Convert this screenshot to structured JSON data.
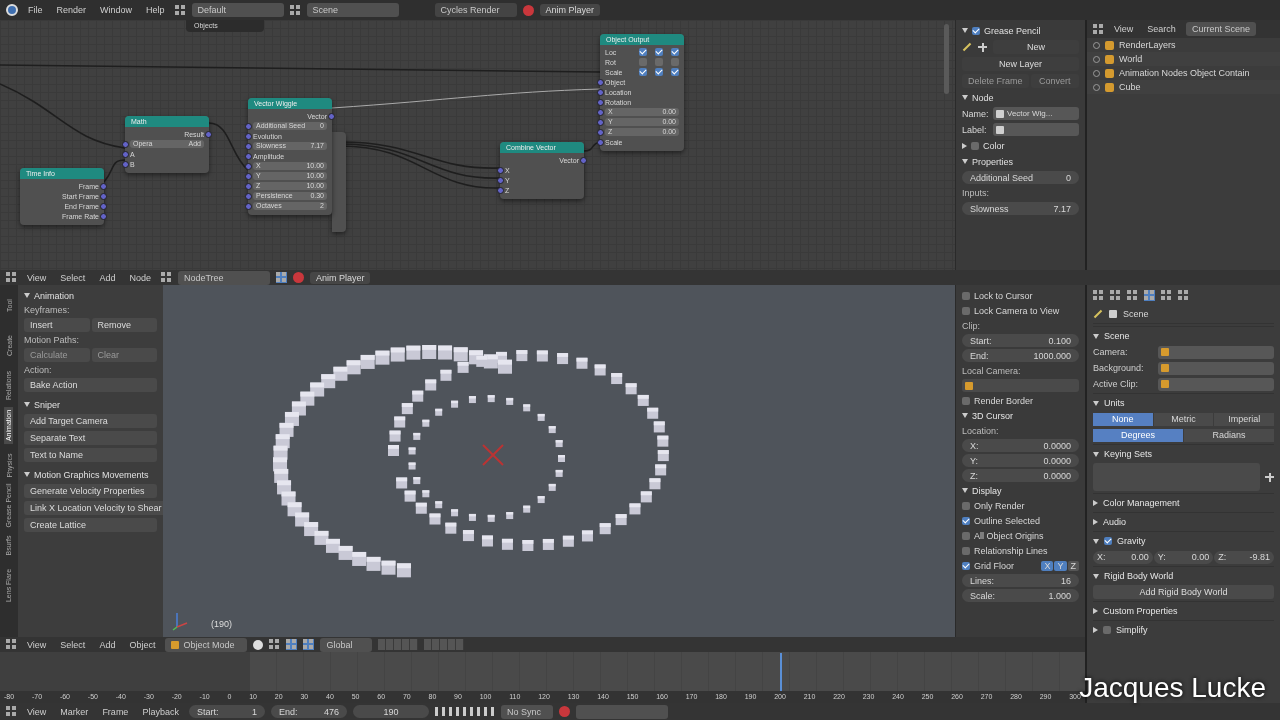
{
  "top_bar": {
    "menus": [
      "File",
      "Render",
      "Window",
      "Help"
    ],
    "layout": "Default",
    "scene": "Scene",
    "engine": "Cycles Render",
    "anim_player": "Anim Player"
  },
  "node_editor": {
    "popup": "Objects",
    "nodes": [
      {
        "title": "Time Info",
        "rows": [
          {
            "kind": "out",
            "text": "Frame"
          },
          {
            "kind": "out",
            "text": "Start Frame"
          },
          {
            "kind": "out",
            "text": "End Frame"
          },
          {
            "kind": "out",
            "text": "Frame Rate"
          }
        ]
      },
      {
        "title": "Math",
        "rows": [
          {
            "kind": "out",
            "text": "Result"
          },
          {
            "kind": "value",
            "text": "Opera",
            "value": "Add"
          },
          {
            "kind": "in",
            "text": "A"
          },
          {
            "kind": "in",
            "text": "B"
          }
        ]
      },
      {
        "title": "Vector Wiggle",
        "rows": [
          {
            "kind": "out",
            "text": "Vector"
          },
          {
            "kind": "value",
            "text": "Additional Seed",
            "value": "0"
          },
          {
            "kind": "in",
            "text": "Evolution"
          },
          {
            "kind": "value",
            "text": "Slowness",
            "value": "7.17"
          },
          {
            "kind": "in",
            "text": "Amplitude"
          },
          {
            "kind": "value",
            "text": "X",
            "value": "10.00"
          },
          {
            "kind": "value",
            "text": "Y",
            "value": "10.00"
          },
          {
            "kind": "value",
            "text": "Z",
            "value": "10.00"
          },
          {
            "kind": "value",
            "text": "Persistence",
            "value": "0.30"
          },
          {
            "kind": "value",
            "text": "Octaves",
            "value": "2"
          }
        ]
      },
      {
        "title": "Combine Vector",
        "rows": [
          {
            "kind": "out",
            "text": "Vector"
          },
          {
            "kind": "in",
            "text": "X"
          },
          {
            "kind": "in",
            "text": "Y"
          },
          {
            "kind": "in",
            "text": "Z"
          }
        ]
      },
      {
        "title": "Object Output",
        "rows": [
          {
            "kind": "checks",
            "text": "Loc",
            "checks": [
              true,
              true,
              true
            ]
          },
          {
            "kind": "checks",
            "text": "Rot",
            "checks": [
              false,
              false,
              false
            ]
          },
          {
            "kind": "checks",
            "text": "Scale",
            "checks": [
              true,
              true,
              true
            ]
          },
          {
            "kind": "in",
            "text": "Object"
          },
          {
            "kind": "in",
            "text": "Location"
          },
          {
            "kind": "in",
            "text": "Rotation"
          },
          {
            "kind": "value",
            "text": "X",
            "value": "0.00"
          },
          {
            "kind": "value",
            "text": "Y",
            "value": "0.00"
          },
          {
            "kind": "value",
            "text": "Z",
            "value": "0.00"
          },
          {
            "kind": "in",
            "text": "Scale"
          }
        ]
      }
    ],
    "header": {
      "menus": [
        "View",
        "Select",
        "Add",
        "Node"
      ],
      "tree": "NodeTree",
      "anim_player": "Anim Player"
    }
  },
  "node_panel": {
    "grease_pencil": {
      "title": "Grease Pencil",
      "checked": true,
      "new": "New",
      "new_layer": "New Layer",
      "delete_frame": "Delete Frame",
      "convert": "Convert"
    },
    "node_section": "Node",
    "name_label": "Name:",
    "name_value": "Vector Wig...",
    "label_label": "Label:",
    "color_section": "Color",
    "color_checked": false,
    "properties_section": "Properties",
    "seed_label": "Additional Seed",
    "seed_value": "0",
    "inputs_label": "Inputs:",
    "slowness_label": "Slowness",
    "slowness_value": "7.17"
  },
  "outliner": {
    "menus": [
      "View",
      "Search"
    ],
    "display": "Current Scene",
    "items": [
      {
        "label": "RenderLayers"
      },
      {
        "label": "World"
      },
      {
        "label": "Animation Nodes Object Contain"
      },
      {
        "label": "Cube"
      }
    ]
  },
  "tool_shelf": {
    "tabs": [
      {
        "label": "Tool",
        "selected": false
      },
      {
        "label": "Create",
        "selected": false
      },
      {
        "label": "Relations",
        "selected": false
      },
      {
        "label": "Animation",
        "selected": true
      },
      {
        "label": "Physics",
        "selected": false
      },
      {
        "label": "Grease Pencil",
        "selected": false
      },
      {
        "label": "Bsurfs",
        "selected": false
      },
      {
        "label": "Lens Flare",
        "selected": false
      }
    ],
    "sections": [
      {
        "title": "Animation",
        "expanded": true,
        "items": [
          {
            "kind": "label",
            "text": "Keyframes:"
          },
          {
            "kind": "buttons",
            "buttons": [
              {
                "text": "Insert",
                "disabled": false
              },
              {
                "text": "Remove",
                "disabled": false
              }
            ]
          },
          {
            "kind": "label",
            "text": "Motion Paths:"
          },
          {
            "kind": "buttons",
            "buttons": [
              {
                "text": "Calculate",
                "disabled": true
              },
              {
                "text": "Clear",
                "disabled": true
              }
            ]
          },
          {
            "kind": "label",
            "text": "Action:"
          },
          {
            "kind": "buttons",
            "buttons": [
              {
                "text": "Bake Action",
                "disabled": false
              }
            ]
          }
        ]
      },
      {
        "title": "Sniper",
        "expanded": true,
        "items": [
          {
            "kind": "buttons",
            "buttons": [
              {
                "text": "Add Target Camera",
                "disabled": false
              }
            ]
          },
          {
            "kind": "buttons",
            "buttons": [
              {
                "text": "Separate Text",
                "disabled": false
              }
            ]
          },
          {
            "kind": "buttons",
            "buttons": [
              {
                "text": "Text to Name",
                "disabled": false
              }
            ]
          }
        ]
      },
      {
        "title": "Motion Graphics Movements",
        "expanded": true,
        "items": [
          {
            "kind": "buttons",
            "buttons": [
              {
                "text": "Generate Velocity Properties",
                "disabled": false
              }
            ]
          },
          {
            "kind": "buttons",
            "buttons": [
              {
                "text": "Link X Location Velocity to Shear",
                "disabled": false
              }
            ]
          },
          {
            "kind": "buttons",
            "buttons": [
              {
                "text": "Create Lattice",
                "disabled": false
              }
            ]
          }
        ]
      }
    ]
  },
  "viewport": {
    "frame": "(190)"
  },
  "view_panel": {
    "items": [
      {
        "kind": "check",
        "text": "Lock to Cursor",
        "checked": false
      },
      {
        "kind": "check",
        "text": "Lock Camera to View",
        "checked": false
      },
      {
        "kind": "label",
        "text": "Clip:"
      },
      {
        "kind": "num",
        "text": "Start:",
        "value": "0.100"
      },
      {
        "kind": "num",
        "text": "End:",
        "value": "1000.000"
      },
      {
        "kind": "label",
        "text": "Local Camera:"
      },
      {
        "kind": "picker"
      },
      {
        "kind": "check",
        "text": "Render Border",
        "checked": false
      },
      {
        "kind": "section",
        "text": "3D Cursor",
        "expanded": true
      },
      {
        "kind": "label",
        "text": "Location:"
      },
      {
        "kind": "num",
        "text": "X:",
        "value": "0.0000"
      },
      {
        "kind": "num",
        "text": "Y:",
        "value": "0.0000"
      },
      {
        "kind": "num",
        "text": "Z:",
        "value": "0.0000"
      },
      {
        "kind": "section",
        "text": "Display",
        "expanded": true
      },
      {
        "kind": "check",
        "text": "Only Render",
        "checked": false
      },
      {
        "kind": "check",
        "text": "Outline Selected",
        "checked": true
      },
      {
        "kind": "check",
        "text": "All Object Origins",
        "checked": false
      },
      {
        "kind": "check",
        "text": "Relationship Lines",
        "checked": false
      },
      {
        "kind": "axes",
        "text": "Grid Floor",
        "checked": true,
        "axes": [
          {
            "text": "X",
            "selected": true
          },
          {
            "text": "Y",
            "selected": true
          },
          {
            "text": "Z",
            "selected": false
          }
        ]
      },
      {
        "kind": "num",
        "text": "Lines:",
        "value": "16"
      },
      {
        "kind": "num",
        "text": "Scale:",
        "value": "1.000"
      }
    ]
  },
  "properties": {
    "breadcrumb": "Scene",
    "items": [
      {
        "kind": "section",
        "text": "Scene",
        "expanded": true
      },
      {
        "kind": "prop",
        "text": "Camera:"
      },
      {
        "kind": "prop",
        "text": "Background:"
      },
      {
        "kind": "prop",
        "text": "Active Clip:"
      },
      {
        "kind": "section",
        "text": "Units",
        "expanded": true
      },
      {
        "kind": "toggles",
        "options": [
          {
            "text": "None",
            "selected": true
          },
          {
            "text": "Metric",
            "selected": false
          },
          {
            "text": "Imperial",
            "selected": false
          }
        ]
      },
      {
        "kind": "toggles",
        "options": [
          {
            "text": "Degrees",
            "selected": true
          },
          {
            "text": "Radians",
            "selected": false
          }
        ]
      },
      {
        "kind": "section",
        "text": "Keying Sets",
        "expanded": true
      },
      {
        "kind": "list"
      },
      {
        "kind": "section",
        "text": "Color Management",
        "expanded": false
      },
      {
        "kind": "section",
        "text": "Audio",
        "expanded": false
      },
      {
        "kind": "checksection",
        "text": "Gravity",
        "expanded": true,
        "checked": true
      },
      {
        "kind": "xyz",
        "values": [
          {
            "label": "X:",
            "value": "0.00"
          },
          {
            "label": "Y:",
            "value": "0.00"
          },
          {
            "label": "Z:",
            "value": "-9.81"
          }
        ]
      },
      {
        "kind": "section",
        "text": "Rigid Body World",
        "expanded": true
      },
      {
        "kind": "button",
        "text": "Add Rigid Body World"
      },
      {
        "kind": "section",
        "text": "Custom Properties",
        "expanded": false
      },
      {
        "kind": "checksection",
        "text": "Simplify",
        "expanded": false,
        "checked": false
      }
    ]
  },
  "view3d_header": {
    "menus": [
      "View",
      "Select",
      "Add",
      "Object"
    ],
    "mode": "Object Mode",
    "orientation": "Global"
  },
  "timeline": {
    "ticks": [
      {
        "label": "-80",
        "current": false
      },
      {
        "label": "-70",
        "current": false
      },
      {
        "label": "-60",
        "current": false
      },
      {
        "label": "-50",
        "current": false
      },
      {
        "label": "-40",
        "current": false
      },
      {
        "label": "-30",
        "current": false
      },
      {
        "label": "-20",
        "current": false
      },
      {
        "label": "-10",
        "current": false
      },
      {
        "label": "0",
        "current": false
      },
      {
        "label": "10",
        "current": false
      },
      {
        "label": "20",
        "current": false
      },
      {
        "label": "30",
        "current": false
      },
      {
        "label": "40",
        "current": false
      },
      {
        "label": "50",
        "current": false
      },
      {
        "label": "60",
        "current": false
      },
      {
        "label": "70",
        "current": false
      },
      {
        "label": "80",
        "current": false
      },
      {
        "label": "90",
        "current": false
      },
      {
        "label": "100",
        "current": false
      },
      {
        "label": "110",
        "current": false
      },
      {
        "label": "120",
        "current": false
      },
      {
        "label": "130",
        "current": false
      },
      {
        "label": "140",
        "current": false
      },
      {
        "label": "150",
        "current": false
      },
      {
        "label": "160",
        "current": false
      },
      {
        "label": "170",
        "current": false
      },
      {
        "label": "180",
        "current": false
      },
      {
        "label": "190",
        "current": false
      },
      {
        "label": "200",
        "current": true
      },
      {
        "label": "210",
        "current": false
      },
      {
        "label": "220",
        "current": false
      },
      {
        "label": "230",
        "current": false
      },
      {
        "label": "240",
        "current": false
      },
      {
        "label": "250",
        "current": false
      },
      {
        "label": "260",
        "current": false
      },
      {
        "label": "270",
        "current": false
      },
      {
        "label": "280",
        "current": false
      },
      {
        "label": "290",
        "current": false
      },
      {
        "label": "300",
        "current": false
      }
    ]
  },
  "timeline_header": {
    "menus": [
      "View",
      "Marker",
      "Frame",
      "Playback"
    ],
    "start_label": "Start:",
    "start": "1",
    "end_label": "End:",
    "end": "476",
    "frame": "190",
    "sync": "No Sync"
  },
  "caption": "Jacques Lucke"
}
